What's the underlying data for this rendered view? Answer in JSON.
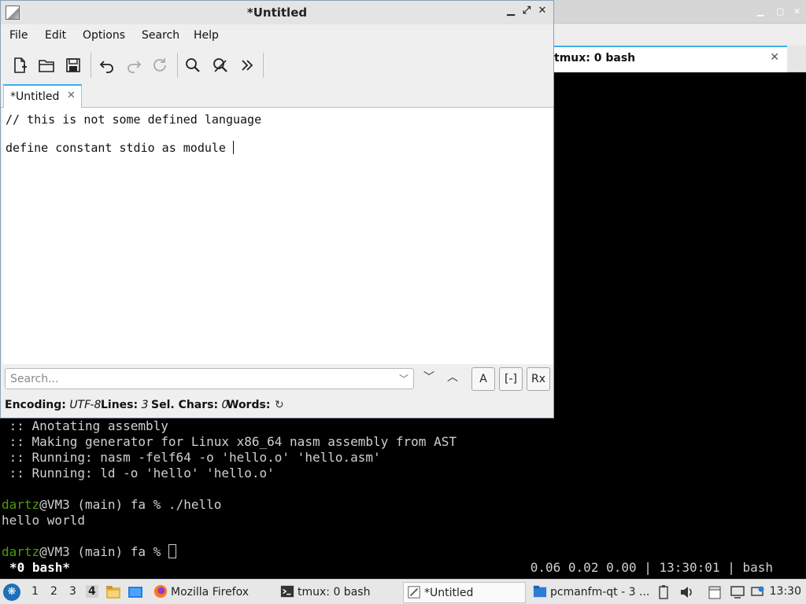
{
  "background_window": {
    "tab_label": "tmux: 0 bash",
    "terminal_lines": [
      " :: Anotating assembly",
      " :: Making generator for Linux x86_64 nasm assembly from AST",
      " :: Running: nasm -felf64 -o 'hello.o' 'hello.asm'",
      " :: Running: ld -o 'hello' 'hello.o'"
    ],
    "prompt1_user": "dartz",
    "prompt1_rest": "@VM3 (main) fa % ./hello",
    "output": "hello world",
    "prompt2_user": "dartz",
    "prompt2_rest": "@VM3 (main) fa % ",
    "tmux_left": "*0 bash*",
    "tmux_right": "0.06 0.02 0.00 | 13:30:01 | bash"
  },
  "editor": {
    "title": "*Untitled",
    "menu": [
      "File",
      "Edit",
      "Options",
      "Search",
      "Help"
    ],
    "tab_label": "*Untitled",
    "lines": [
      "// this is not some defined language",
      "define constant stdio as module "
    ],
    "search_placeholder": "Search...",
    "option_buttons": [
      "A",
      "[-]",
      "Rx"
    ],
    "status": {
      "encoding_label": "Encoding:",
      "encoding_value": "UTF-8",
      "lines_label": "Lines:",
      "lines_value": "3",
      "sel_label": "Sel. Chars:",
      "sel_value": "0",
      "words_label": "Words:"
    }
  },
  "taskbar": {
    "desktops": [
      "1",
      "2",
      "3",
      "4"
    ],
    "active_desktop": "4",
    "tasks": [
      "Mozilla Firefox",
      "tmux: 0 bash",
      "*Untitled",
      "pcmanfm-qt - 3 ..."
    ],
    "clock": "13:30"
  }
}
